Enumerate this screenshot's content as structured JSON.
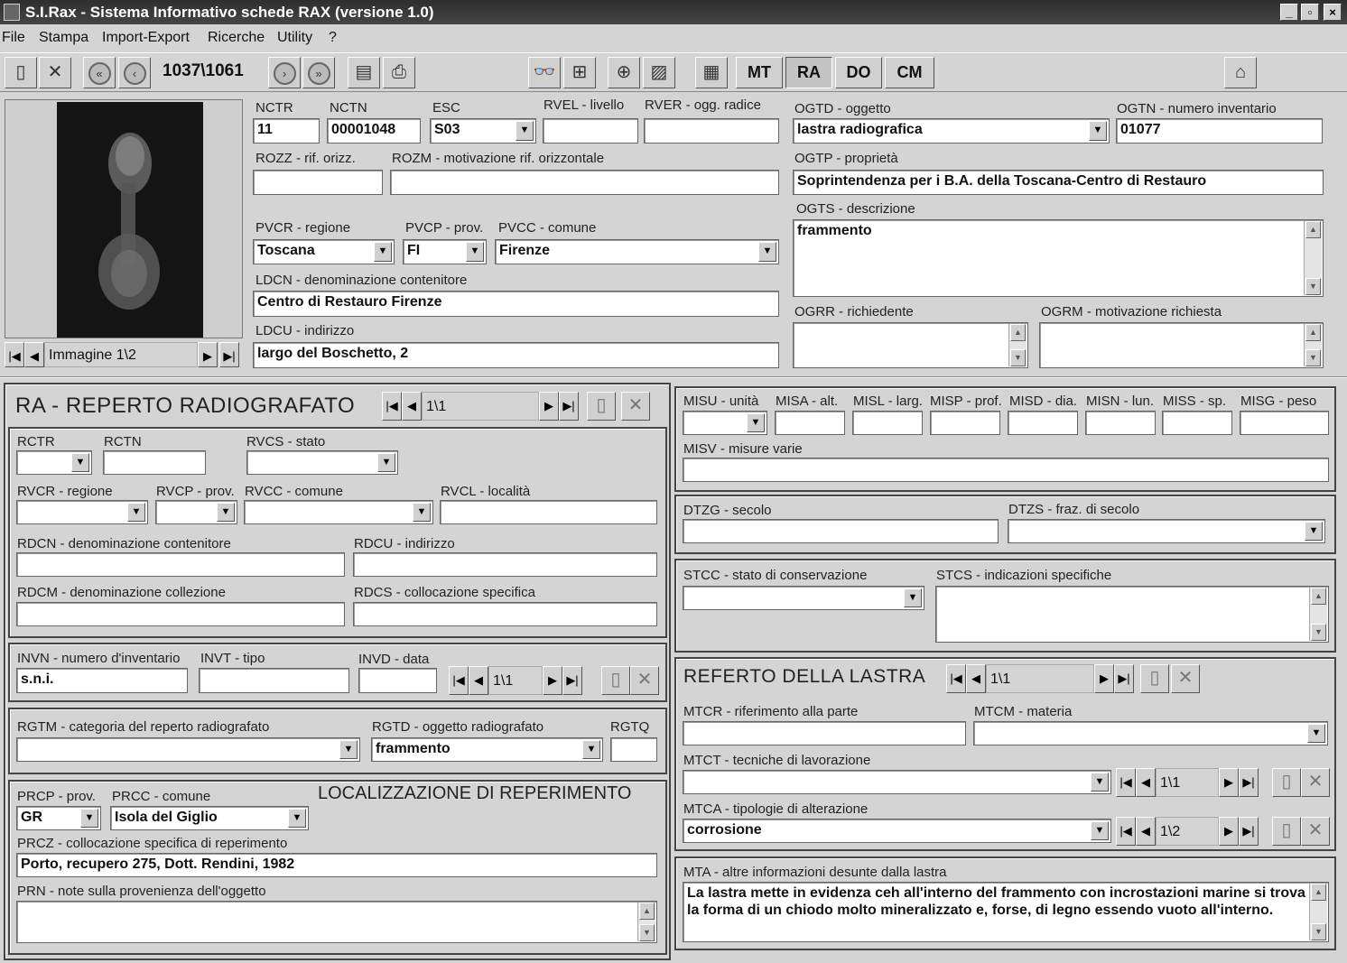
{
  "window": {
    "title": "S.I.Rax - Sistema Informativo schede RAX (versione 1.0)",
    "min": "_",
    "max": "▫",
    "close": "×"
  },
  "menu": [
    "File",
    "Stampa",
    "Import-Export",
    "Ricerche",
    "Utility",
    "?"
  ],
  "toolbar": {
    "record": "1037\\1061",
    "tabs": [
      "MT",
      "RA",
      "DO",
      "CM"
    ],
    "active_tab": "RA"
  },
  "image_nav": {
    "label": "Immagine 1\\2"
  },
  "header": {
    "nctr": {
      "label": "NCTR",
      "value": "11"
    },
    "nctn": {
      "label": "NCTN",
      "value": "00001048"
    },
    "esc": {
      "label": "ESC",
      "value": "S03"
    },
    "rvel": {
      "label": "RVEL - livello",
      "value": ""
    },
    "rver": {
      "label": "RVER - ogg. radice",
      "value": ""
    },
    "rozz": {
      "label": "ROZZ - rif. orizz.",
      "value": ""
    },
    "rozm": {
      "label": "ROZM - motivazione rif. orizzontale",
      "value": ""
    },
    "pvcr": {
      "label": "PVCR - regione",
      "value": "Toscana"
    },
    "pvcp": {
      "label": "PVCP - prov.",
      "value": "FI"
    },
    "pvcc": {
      "label": "PVCC - comune",
      "value": "Firenze"
    },
    "ldcn": {
      "label": "LDCN - denominazione contenitore",
      "value": "Centro di Restauro Firenze"
    },
    "ldcu": {
      "label": "LDCU - indirizzo",
      "value": "largo del Boschetto, 2"
    },
    "ogtd": {
      "label": "OGTD - oggetto",
      "value": "lastra radiografica"
    },
    "ogtn": {
      "label": "OGTN - numero inventario",
      "value": "01077"
    },
    "ogtp": {
      "label": "OGTP - proprietà",
      "value": "Soprintendenza per i B.A. della Toscana-Centro di Restauro"
    },
    "ogts": {
      "label": "OGTS - descrizione",
      "value": "frammento"
    },
    "ogrr": {
      "label": "OGRR - richiedente",
      "value": ""
    },
    "ogrm": {
      "label": "OGRM - motivazione richiesta",
      "value": ""
    }
  },
  "ra": {
    "title": "RA - REPERTO RADIOGRAFATO",
    "nav": "1\\1",
    "rctr": "RCTR",
    "rctn": "RCTN",
    "rvcs": "RVCS - stato",
    "rvcr": "RVCR - regione",
    "rvcp": "RVCP - prov.",
    "rvcc": "RVCC - comune",
    "rvcl": "RVCL - località",
    "rdcn": "RDCN - denominazione contenitore",
    "rdcu": "RDCU - indirizzo",
    "rdcm": "RDCM - denominazione collezione",
    "rdcs": "RDCS - collocazione specifica",
    "invn": {
      "label": "INVN - numero d'inventario",
      "value": "s.n.i."
    },
    "invt": "INVT - tipo",
    "invd": "INVD - data",
    "inv_nav": "1\\1",
    "rgtm": "RGTM - categoria del reperto radiografato",
    "rgtd": {
      "label": "RGTD - oggetto radiografato",
      "value": "frammento"
    },
    "rgtq": "RGTQ"
  },
  "loc": {
    "title": "LOCALIZZAZIONE DI REPERIMENTO",
    "prcp": {
      "label": "PRCP - prov.",
      "value": "GR"
    },
    "prcc": {
      "label": "PRCC - comune",
      "value": "Isola del Giglio"
    },
    "prcz": {
      "label": "PRCZ - collocazione specifica di reperimento",
      "value": "Porto, recupero 275, Dott. Rendini, 1982"
    },
    "prn": {
      "label": "PRN - note sulla provenienza dell'oggetto",
      "value": ""
    }
  },
  "mis": {
    "misu": "MISU - unità",
    "misa": "MISA - alt.",
    "misl": "MISL - larg.",
    "misp": "MISP - prof.",
    "misd": "MISD - dia.",
    "misn": "MISN - lun.",
    "miss": "MISS - sp.",
    "misg": "MISG - peso",
    "misv": "MISV - misure varie"
  },
  "dt": {
    "dtzg": "DTZG - secolo",
    "dtzs": "DTZS - fraz. di secolo"
  },
  "st": {
    "stcc": "STCC - stato di conservazione",
    "stcs": "STCS - indicazioni specifiche"
  },
  "ref": {
    "title": "REFERTO DELLA LASTRA",
    "nav": "1\\1",
    "mtcr": "MTCR - riferimento alla parte",
    "mtcm": "MTCM - materia",
    "mtct": "MTCT - tecniche di lavorazione",
    "mtct_nav": "1\\1",
    "mtca": {
      "label": "MTCA - tipologie di alterazione",
      "value": "corrosione"
    },
    "mtca_nav": "1\\2",
    "mta": {
      "label": "MTA - altre informazioni desunte dalla lastra",
      "value": "La lastra mette in evidenza ceh all'interno del frammento con incrostazioni marine si trova la forma di un chiodo molto mineralizzato e, forse, di legno essendo vuoto all'interno."
    }
  }
}
